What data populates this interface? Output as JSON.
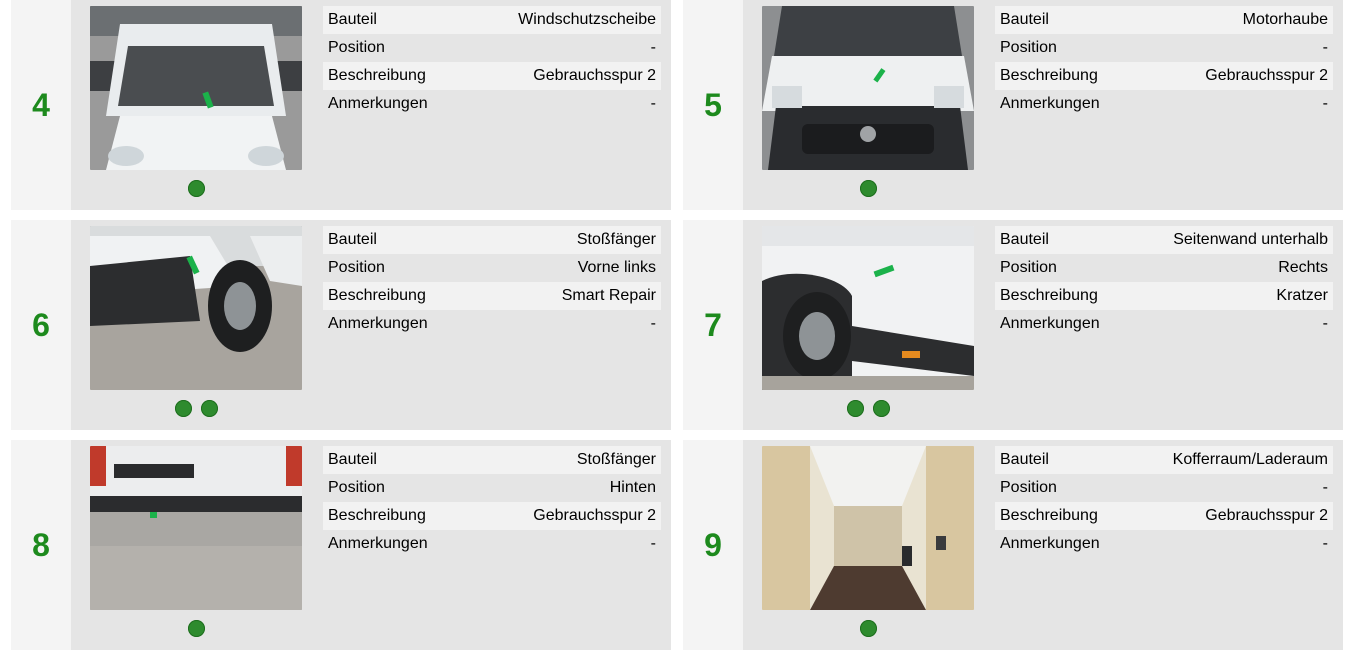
{
  "cards": [
    {
      "number": "4",
      "rows": [
        {
          "label": "Bauteil",
          "value": "Windschutzscheibe"
        },
        {
          "label": "Position",
          "value": "-"
        },
        {
          "label": "Beschreibung",
          "value": "Gebrauchsspur 2"
        },
        {
          "label": "Anmerkungen",
          "value": "-"
        }
      ],
      "photo": "van-front-windshield",
      "dot_count": 1
    },
    {
      "number": "5",
      "rows": [
        {
          "label": "Bauteil",
          "value": "Motorhaube"
        },
        {
          "label": "Position",
          "value": "-"
        },
        {
          "label": "Beschreibung",
          "value": "Gebrauchsspur 2"
        },
        {
          "label": "Anmerkungen",
          "value": "-"
        }
      ],
      "photo": "van-front-grille",
      "dot_count": 1
    },
    {
      "number": "6",
      "rows": [
        {
          "label": "Bauteil",
          "value": "Stoßfänger"
        },
        {
          "label": "Position",
          "value": "Vorne links"
        },
        {
          "label": "Beschreibung",
          "value": "Smart Repair"
        },
        {
          "label": "Anmerkungen",
          "value": "-"
        }
      ],
      "photo": "van-front-left-bumper",
      "dot_count": 2
    },
    {
      "number": "7",
      "rows": [
        {
          "label": "Bauteil",
          "value": "Seitenwand unterhalb"
        },
        {
          "label": "Position",
          "value": "Rechts"
        },
        {
          "label": "Beschreibung",
          "value": "Kratzer"
        },
        {
          "label": "Anmerkungen",
          "value": "-"
        }
      ],
      "photo": "van-right-side-panel",
      "dot_count": 2
    },
    {
      "number": "8",
      "rows": [
        {
          "label": "Bauteil",
          "value": "Stoßfänger"
        },
        {
          "label": "Position",
          "value": "Hinten"
        },
        {
          "label": "Beschreibung",
          "value": "Gebrauchsspur 2"
        },
        {
          "label": "Anmerkungen",
          "value": "-"
        }
      ],
      "photo": "van-rear-bumper",
      "dot_count": 1
    },
    {
      "number": "9",
      "rows": [
        {
          "label": "Bauteil",
          "value": "Kofferraum/Laderaum"
        },
        {
          "label": "Position",
          "value": "-"
        },
        {
          "label": "Beschreibung",
          "value": "Gebrauchsspur 2"
        },
        {
          "label": "Anmerkungen",
          "value": "-"
        }
      ],
      "photo": "van-cargo-area",
      "dot_count": 1
    }
  ],
  "colors": {
    "number": "#1d8a1d",
    "dot": "#2e8b2e",
    "card_bg": "#e5e5e5",
    "number_col_bg": "#f4f4f4",
    "row_alt_bg": "#f2f2f2"
  }
}
